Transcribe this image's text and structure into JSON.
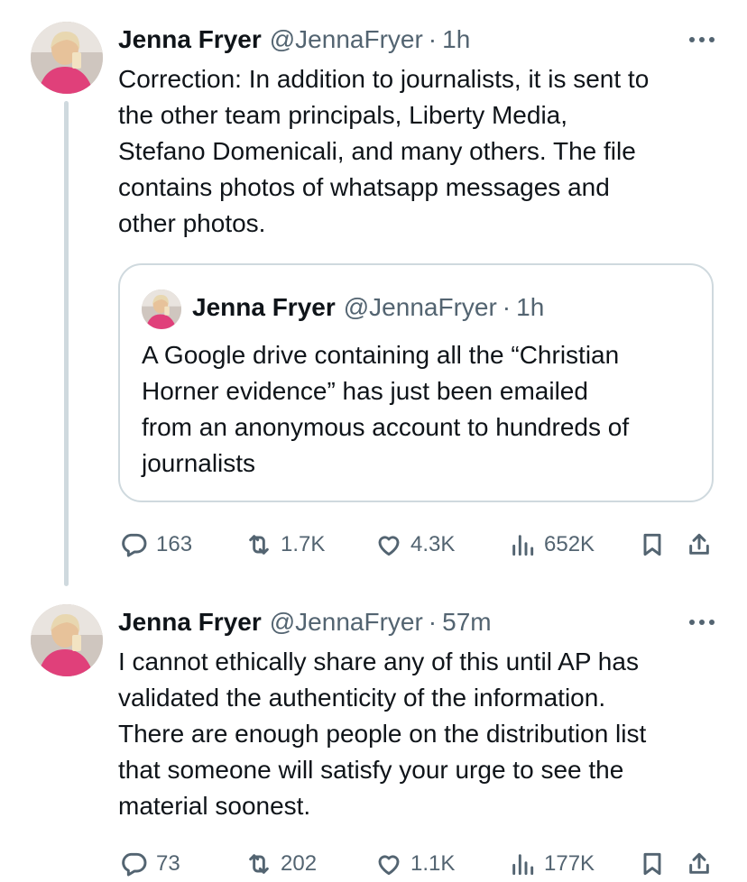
{
  "tweets": [
    {
      "author_name": "Jenna Fryer",
      "handle": "@JennaFryer",
      "separator": "·",
      "time": "1h",
      "text": "Correction: In addition to journalists, it is sent to\nthe other team principals, Liberty Media,\nStefano Domenicali, and many others. The file\ncontains photos of whatsapp messages and\nother photos.",
      "quoted_tweet": {
        "author_name": "Jenna Fryer",
        "handle": "@JennaFryer",
        "separator": "·",
        "time": "1h",
        "text": "A Google drive containing all the “Christian\nHorner evidence” has just been emailed\nfrom an anonymous account to hundreds of\njournalists"
      },
      "stats": {
        "replies": "163",
        "reposts": "1.7K",
        "likes": "4.3K",
        "views": "652K"
      }
    },
    {
      "author_name": "Jenna Fryer",
      "handle": "@JennaFryer",
      "separator": "·",
      "time": "57m",
      "text": "I cannot ethically share any of this until AP has\nvalidated the authenticity of the information.\nThere are enough people on the distribution list\nthat someone will satisfy your urge to see the\nmaterial soonest.",
      "stats": {
        "replies": "73",
        "reposts": "202",
        "likes": "1.1K",
        "views": "177K"
      }
    }
  ],
  "icons": {
    "reply": "reply-icon",
    "repost": "repost-icon",
    "like": "heart-icon",
    "views": "views-icon",
    "bookmark": "bookmark-icon",
    "share": "share-icon",
    "more": "more-icon"
  },
  "colors": {
    "text": "#0f1419",
    "secondary": "#536471",
    "border": "#cfd9de",
    "background": "#ffffff"
  }
}
